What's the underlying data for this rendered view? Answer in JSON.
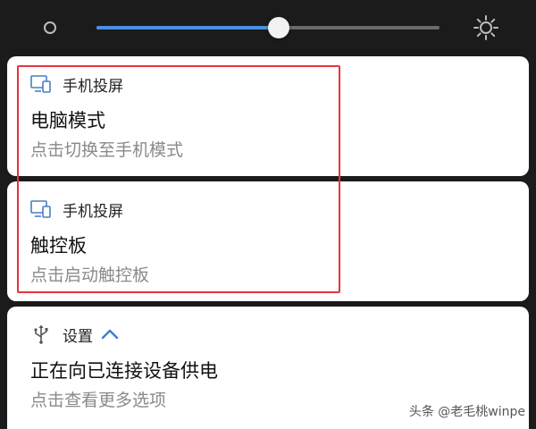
{
  "brightness": {
    "level": 0.53,
    "low_icon": "brightness-low-icon",
    "high_icon": "brightness-high-icon",
    "accent": "#4a90e2"
  },
  "notifications": [
    {
      "app_name": "手机投屏",
      "app_icon": "screen-cast-icon",
      "title": "电脑模式",
      "subtitle": "点击切换至手机模式"
    },
    {
      "app_name": "手机投屏",
      "app_icon": "screen-cast-icon",
      "title": "触控板",
      "subtitle": "点击启动触控板"
    },
    {
      "app_name": "设置",
      "app_icon": "usb-icon",
      "expand_icon": "chevron-up-icon",
      "title": "正在向已连接设备供电",
      "subtitle": "点击查看更多选项"
    }
  ],
  "highlight_color": "#e8333e",
  "watermark": "头条 @老毛桃winpe"
}
